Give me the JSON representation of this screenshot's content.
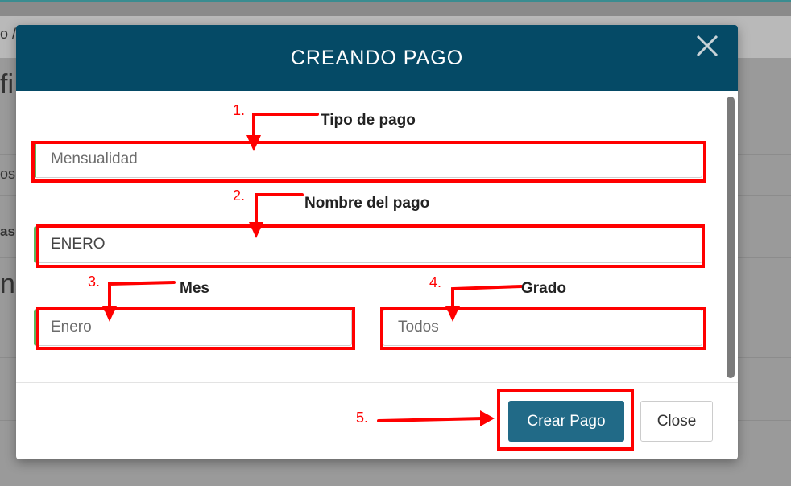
{
  "modal": {
    "title": "CREANDO PAGO",
    "close_icon": "close-icon"
  },
  "background": {
    "fragments": [
      "o /",
      "fi",
      "os",
      "asu",
      "ns"
    ]
  },
  "form": {
    "tipo_de_pago": {
      "value": "Mensualidad"
    },
    "nombre_del_pago": {
      "value": "ENERO"
    },
    "mes": {
      "value": "Enero"
    },
    "grado": {
      "value": "Todos"
    }
  },
  "annotations": [
    {
      "number": "1.",
      "label": "Tipo de pago"
    },
    {
      "number": "2.",
      "label": "Nombre del pago"
    },
    {
      "number": "3.",
      "label": "Mes"
    },
    {
      "number": "4.",
      "label": "Grado"
    },
    {
      "number": "5.",
      "label": ""
    }
  ],
  "footer": {
    "primary_label": "Crear Pago",
    "secondary_label": "Close"
  },
  "colors": {
    "header": "#054a66",
    "primary_button": "#216a87",
    "highlight": "#ff0000",
    "valid_border": "#5cb85c"
  }
}
